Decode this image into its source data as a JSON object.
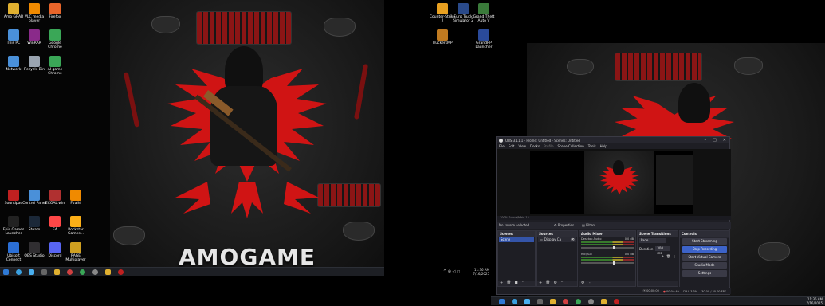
{
  "monitor1": {
    "brand_text": "AMOGAME",
    "desktop_icons": [
      {
        "label": "Amo GRAB",
        "icon": "app-icon",
        "color": "#e0b030"
      },
      {
        "label": "VLC media player",
        "icon": "vlc-icon",
        "color": "#f08a00"
      },
      {
        "label": "Firefox",
        "icon": "firefox-icon",
        "color": "#e8652a"
      },
      {
        "label": "This PC",
        "icon": "computer-icon",
        "color": "#4a90d9"
      },
      {
        "label": "WinRAR",
        "icon": "winrar-icon",
        "color": "#8a2a8a"
      },
      {
        "label": "Google Chrome",
        "icon": "chrome-icon",
        "color": "#3aa757"
      },
      {
        "label": "Network",
        "icon": "network-icon",
        "color": "#4a90d9"
      },
      {
        "label": "Recycle Bin",
        "icon": "recycle-bin-icon",
        "color": "#9aa4b0"
      },
      {
        "label": "AI game Chrome",
        "icon": "chrome-icon",
        "color": "#3aa757"
      },
      {
        "label": "Soundpad",
        "icon": "soundpad-icon",
        "color": "#c02020"
      },
      {
        "label": "Control Panel",
        "icon": "control-panel-icon",
        "color": "#4a90d9"
      },
      {
        "label": "ECOAL.win",
        "icon": "app-icon",
        "color": "#b03030"
      },
      {
        "label": "Fvalhl",
        "icon": "app-icon",
        "color": "#f08a00"
      },
      {
        "label": "Epic Games Launcher",
        "icon": "epic-icon",
        "color": "#222222"
      },
      {
        "label": "Steam",
        "icon": "steam-icon",
        "color": "#1b2838"
      },
      {
        "label": "EA",
        "icon": "ea-icon",
        "color": "#ff4747"
      },
      {
        "label": "Rockstar Games...",
        "icon": "rockstar-icon",
        "color": "#fcaf17"
      },
      {
        "label": "Ubisoft Connect",
        "icon": "ubisoft-icon",
        "color": "#2b6fd6"
      },
      {
        "label": "OBS Studio",
        "icon": "obs-icon",
        "color": "#302e31"
      },
      {
        "label": "Discord",
        "icon": "discord-icon",
        "color": "#5865f2"
      },
      {
        "label": "RAGE Multiplayer",
        "icon": "rage-icon",
        "color": "#d0a020"
      }
    ],
    "taskbar": {
      "time": "11:36 AM",
      "date": "7/16/2025"
    }
  },
  "monitor2": {
    "desktop_icons": [
      {
        "label": "Counter-Strike 2",
        "icon": "cs2-icon",
        "color": "#e8a020"
      },
      {
        "label": "Euro Truck Simulator 2",
        "icon": "ets2-icon",
        "color": "#2a4a8a"
      },
      {
        "label": "Grand Theft Auto V",
        "icon": "gta-icon",
        "color": "#3a7a3a"
      },
      {
        "label": "TruckersMP",
        "icon": "truckersmp-icon",
        "color": "#c07a20"
      },
      {
        "label": "GrandRP Launcher",
        "icon": "grandrp-icon",
        "color": "#2a4a9a"
      }
    ],
    "taskbar": {
      "time": "11:36 AM",
      "date": "7/16/2025"
    }
  },
  "obs": {
    "title": "OBS 31.1.1 - Profile: Untitled - Scenes: Untitled",
    "menu": [
      "File",
      "Edit",
      "View",
      "Docks",
      "Profile",
      "Scene Collection",
      "Tools",
      "Help"
    ],
    "rescale_text": "100%  Scene/Main 15",
    "no_source": "No source selected",
    "properties": "Properties",
    "filters": "Filters",
    "scenes": {
      "header": "Scenes",
      "items": [
        "Scene"
      ]
    },
    "sources": {
      "header": "Sources",
      "items": [
        "Display Ca"
      ]
    },
    "mixer": {
      "header": "Audio Mixer",
      "channels": [
        {
          "name": "Desktop Audio",
          "db": "0.0 dB"
        },
        {
          "name": "Mic/Aux",
          "db": "0.0 dB"
        }
      ]
    },
    "transitions": {
      "header": "Scene Transitions",
      "type": "Fade",
      "duration_label": "Duration",
      "duration": "300 ms"
    },
    "controls": {
      "header": "Controls",
      "buttons": [
        "Start Streaming",
        "Stop Recording",
        "Start Virtual Camera",
        "Studio Mode",
        "Settings"
      ]
    },
    "status": {
      "stream": "00:00:00",
      "rec": "00:04:49",
      "cpu": "CPU: 3.3%",
      "fps": "30.00 / 30.00 FPS"
    }
  }
}
